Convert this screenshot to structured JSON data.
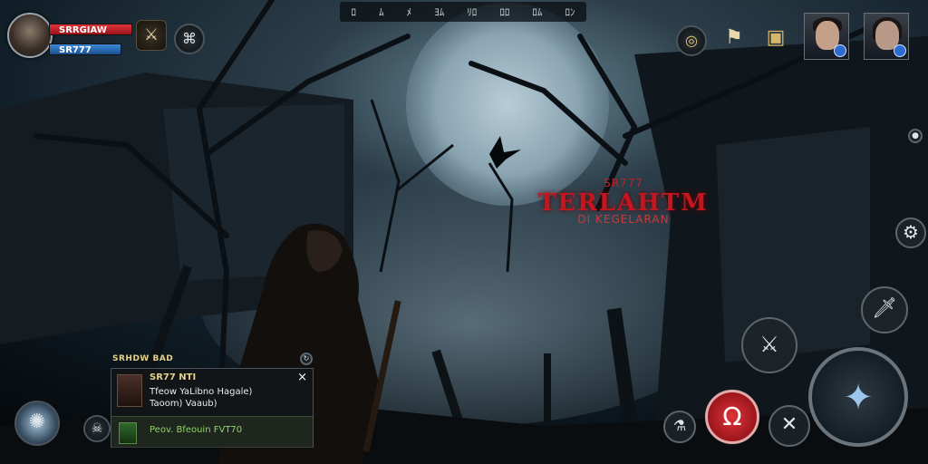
{
  "player": {
    "hp_label": "SRRGIAW",
    "mp_label": "SR777"
  },
  "top_strip": {
    "items": [
      "ﾛ",
      "ﾑ",
      "ﾒ",
      "ﾖﾑ",
      "ﾘﾛ",
      "ﾛﾛ",
      "ﾛﾑ",
      "ﾛﾝ"
    ]
  },
  "map_title": {
    "tag": "SR777",
    "main": "TERLAHTM",
    "sub": "DI KEGELARAN"
  },
  "quest_panel": {
    "header": "SRHDW BAD",
    "title": "SR77 NTI",
    "line1": "Tfeow YaLibno Hagale)",
    "line2": "Taoom) Vaaub)",
    "reward": "Peov. Bfeouin FVT70",
    "close": "×"
  },
  "colors": {
    "accent_red": "#d3242b",
    "title_red": "#c4161e",
    "quest_gold": "#e6d28a",
    "reward_green": "#8fd36a"
  },
  "icons": {
    "settings": "gear-icon",
    "attack": "attack-icon",
    "skill1": "sword-skill-icon",
    "skill2": "crossed-blades-icon"
  }
}
